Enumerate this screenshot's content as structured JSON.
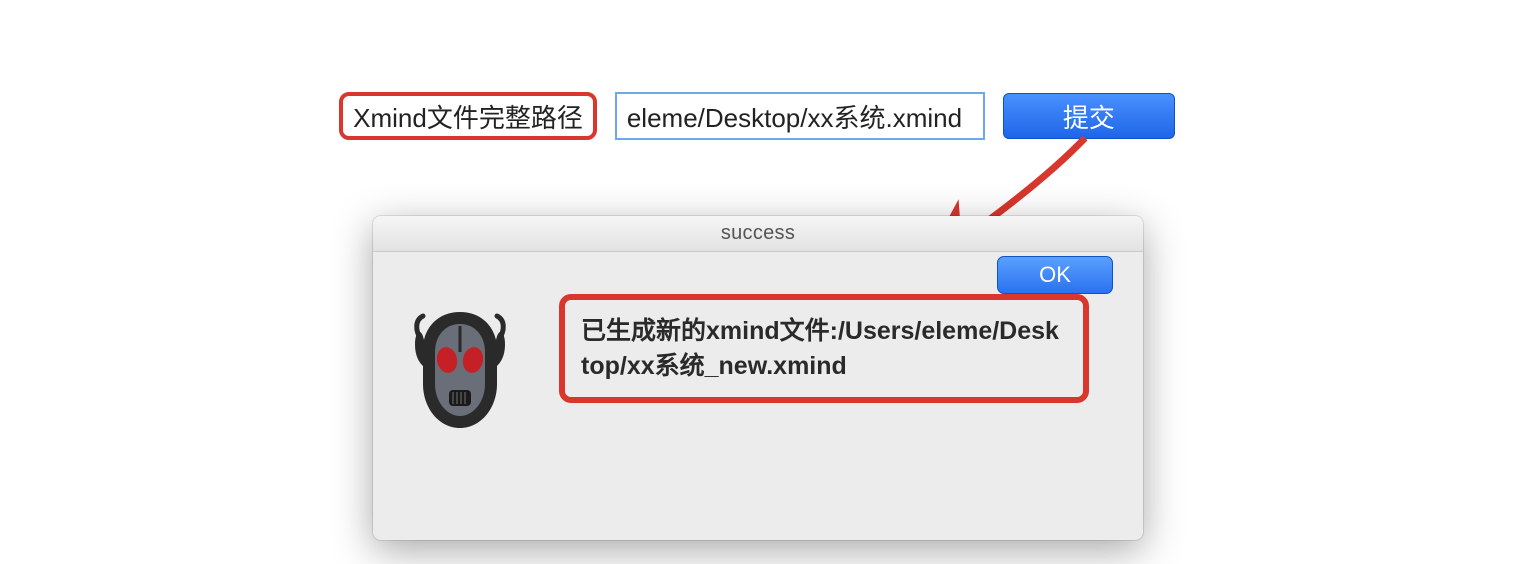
{
  "form": {
    "label": "Xmind文件完整路径",
    "path_value": "eleme/Desktop/xx系统.xmind",
    "submit_label": "提交"
  },
  "dialog": {
    "title": "success",
    "message": "已生成新的xmind文件:/Users/eleme/Desktop/xx系统_new.xmind",
    "ok_label": "OK"
  },
  "annotation": {
    "arrow_color": "#d9362d",
    "highlight_color": "#d9362d"
  }
}
